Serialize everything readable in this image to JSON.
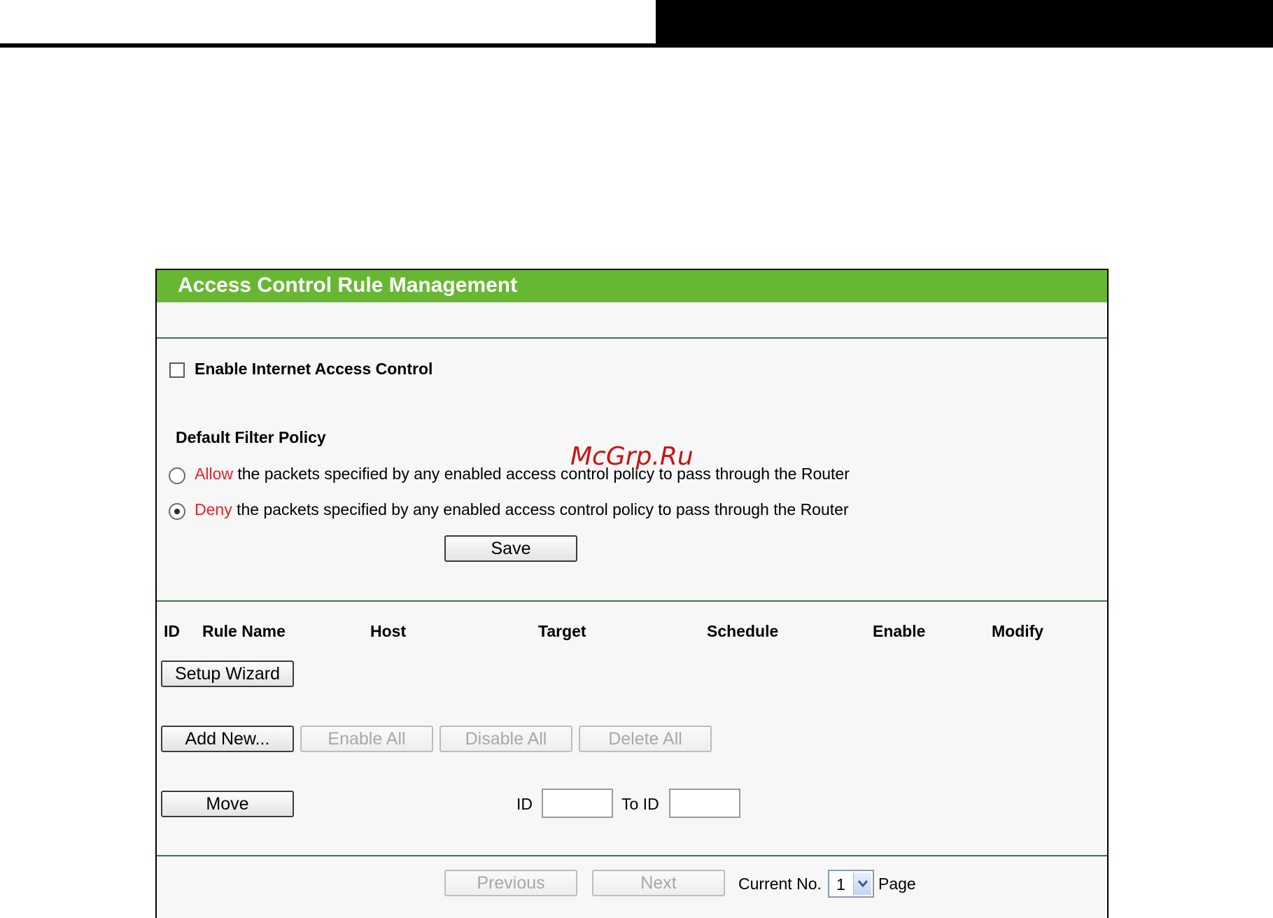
{
  "panel": {
    "title": "Access Control Rule Management"
  },
  "enable_control": {
    "label": "Enable Internet Access Control",
    "checked": false
  },
  "filter_policy": {
    "heading": "Default Filter Policy",
    "allow_keyword": "Allow",
    "allow_rest": " the packets specified by any enabled access control policy to pass through the Router",
    "deny_keyword": "Deny",
    "deny_rest": " the packets specified by any enabled access control policy to pass through the Router",
    "selected": "Deny",
    "save_label": "Save"
  },
  "table": {
    "columns": [
      "ID",
      "Rule Name",
      "Host",
      "Target",
      "Schedule",
      "Enable",
      "Modify"
    ]
  },
  "actions": {
    "setup_wizard": "Setup Wizard",
    "add_new": "Add New...",
    "enable_all": "Enable All",
    "disable_all": "Disable All",
    "delete_all": "Delete All",
    "move": "Move",
    "id_label": "ID",
    "to_id_label": "To ID",
    "id_value": "",
    "to_id_value": ""
  },
  "pagination": {
    "previous": "Previous",
    "next": "Next",
    "current_label": "Current No.",
    "current_value": "1",
    "page_label": "Page"
  },
  "watermark": "McGrp.Ru",
  "colors": {
    "header_green": "#68b733",
    "divider_green": "#2e7d4b",
    "keyword_red": "#e8232a"
  }
}
